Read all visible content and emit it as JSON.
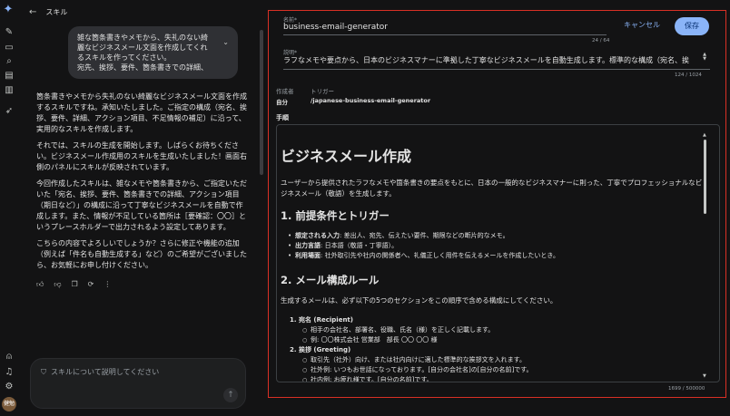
{
  "chat": {
    "back_label": "スキル",
    "user_message": "雑な箇条書きやメモから、失礼のない綺麗なビジネスメール文面を作成してくれるスキルを作ってください。\n宛先、挨拶、要件、箇条書きでの詳細、",
    "response": [
      "箇条書きやメモから失礼のない綺麗なビジネスメール文面を作成するスキルですね。承知いたしました。ご指定の構成（宛名、挨拶、要件、詳細、アクション項目、不足情報の補足）に沿って、実用的なスキルを作成します。",
      "それでは、スキルの生成を開始します。しばらくお待ちください。ビジネスメール作成用のスキルを生成いたしました！画面右側のパネルにスキルが反映されています。",
      "今回作成したスキルは、雑なメモや箇条書きから、ご指定いただいた「宛名、挨拶、要件、箇条書きでの詳細、アクション項目（期日など）」の構成に沿って丁寧なビジネスメールを自動で作成します。また、情報が不足している箇所は［要確認：〇〇］というプレースホルダーで出力されるよう設定してあります。",
      "こちらの内容でよろしいでしょうか？さらに修正や機能の追加（例えば「件名も自動生成する」など）のご希望がございましたら、お気軽にお申し付けください。"
    ],
    "composer_placeholder": "スキルについて説明してください",
    "avatar_text": "健勉"
  },
  "panel": {
    "name_label": "名前*",
    "name_value": "business-email-generator",
    "name_counter": "24 / 64",
    "cancel_label": "キャンセル",
    "save_label": "保存",
    "desc_label": "説明*",
    "desc_value": "ラフなメモや要点から、日本のビジネスマナーに準拠した丁寧なビジネスメールを自動生成します。標準的な構成（宛名、挨",
    "desc_counter": "124 / 1024",
    "author_key": "作成者",
    "author_val": "自分",
    "trigger_key": "トリガー",
    "trigger_val": "/japanese-business-email-generator",
    "steps_label": "手順",
    "char_count": "1699 / 500000"
  },
  "doc": {
    "h1": "ビジネスメール作成",
    "intro": "ユーザーから提供されたラフなメモや箇条書きの要点をもとに、日本の一般的なビジネスマナーに則った、丁寧でプロフェッショナルなビジネスメール（敬語）を生成します。",
    "h2_1": "1. 前提条件とトリガー",
    "b1_key": "想定される入力",
    "b1_val": ": 差出人、宛先、伝えたい要件、期限などの断片的なメモ。",
    "b2_key": "出力言語",
    "b2_val": ": 日本語（敬語・丁寧語）。",
    "b3_key": "利用場面",
    "b3_val": ": 社外取引先や社内の関係者へ、礼儀正しく用件を伝えるメールを作成したいとき。",
    "h2_2": "2. メール構成ルール",
    "rule_intro": "生成するメールは、必ず以下の5つのセクションをこの順序で含める構成にしてください。",
    "s1_title": "1.  宛名 (Recipient)",
    "s1_sub1": "相手の会社名、部署名、役職、氏名（様）を正しく記載します。",
    "s1_sub2": "例: 〇〇株式会社 営業部　部長 〇〇 〇〇 様",
    "s2_title": "2.  挨拶 (Greeting)",
    "s2_sub1": "取引先（社外）向け、または社内向けに適した標準的な挨拶文を入れます。",
    "s2_sub2": "社外例: いつもお世話になっております。[自分の会社名]の[自分の名前]です。",
    "s2_sub3": "社内例: お疲れ様です。[自分の名前]です。"
  }
}
